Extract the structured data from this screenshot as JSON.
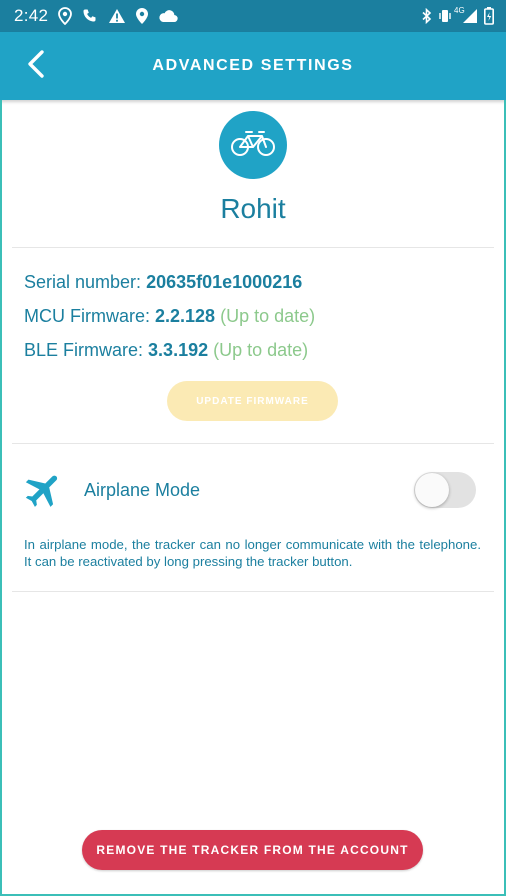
{
  "status_bar": {
    "time": "2:42",
    "network_label": "4G",
    "icons": [
      "location-icon",
      "phone-icon",
      "warning-icon",
      "map-pin-icon",
      "cloud-icon",
      "bluetooth-icon",
      "vibrate-icon",
      "signal-icon",
      "battery-icon"
    ]
  },
  "app_bar": {
    "title": "ADVANCED SETTINGS",
    "back_icon": "chevron-left-icon"
  },
  "device": {
    "icon": "bicycle-icon",
    "name": "Rohit"
  },
  "info": {
    "serial_label": "Serial number:",
    "serial_value": "20635f01e1000216",
    "mcu_label": "MCU Firmware:",
    "mcu_value": "2.2.128",
    "mcu_status": "(Up to date)",
    "ble_label": "BLE Firmware:",
    "ble_value": "3.3.192",
    "ble_status": "(Up to date)"
  },
  "update_button": {
    "label": "UPDATE FIRMWARE",
    "enabled": false
  },
  "airplane_mode": {
    "icon": "airplane-icon",
    "label": "Airplane Mode",
    "enabled": false,
    "description": "In airplane mode, the tracker can no longer communicate with the telephone. It can be reactivated by long pressing the tracker button."
  },
  "remove_button": {
    "label": "REMOVE THE TRACKER FROM THE ACCOUNT"
  },
  "colors": {
    "status_bar": "#1b7f9f",
    "app_bar": "#20a3c6",
    "text_primary": "#1b7f9f",
    "status_ok": "#8cc98c",
    "update_disabled": "#fbeab4",
    "remove": "#d63a53",
    "frame_border": "#3bbfb8"
  }
}
